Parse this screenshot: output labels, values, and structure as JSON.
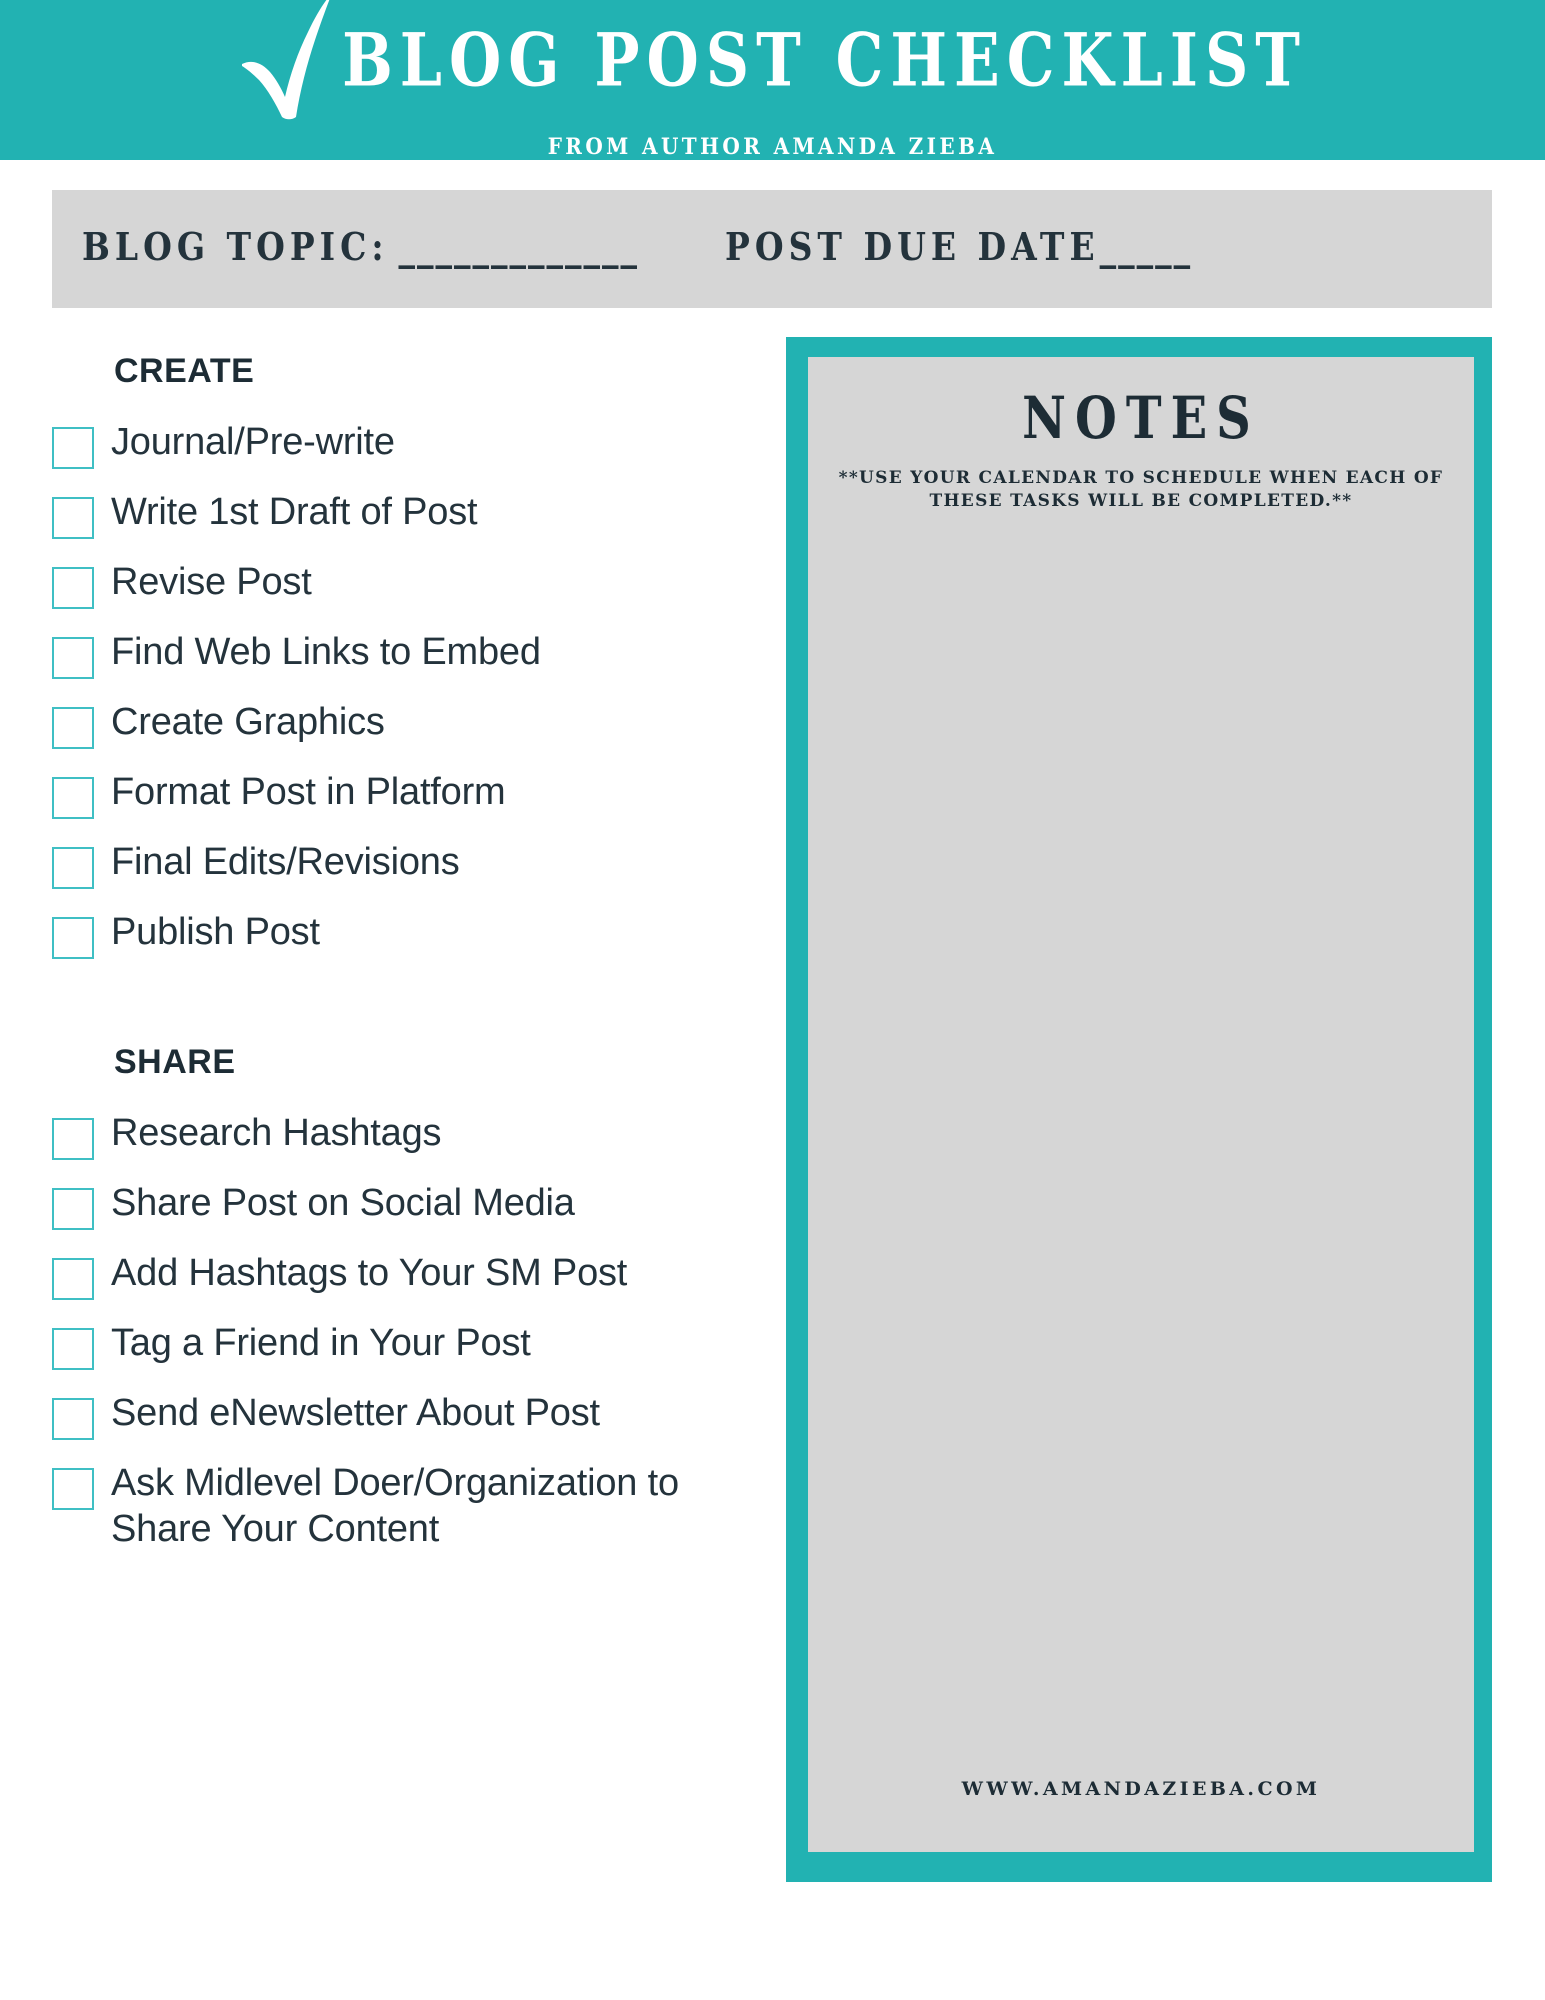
{
  "header": {
    "title": "BLOG POST CHECKLIST",
    "subtitle": "FROM AUTHOR AMANDA ZIEBA",
    "check_icon": "check-icon",
    "background_color": "#22b2b2"
  },
  "topic_bar": {
    "topic_label": "BLOG TOPIC:",
    "topic_rule": "_____________",
    "due_label": "POST DUE DATE",
    "due_rule": "_____",
    "background_color": "#d6d6d6"
  },
  "sections": [
    {
      "heading": "CREATE",
      "items": [
        "Journal/Pre-write",
        "Write 1st Draft of Post",
        "Revise Post",
        "Find Web Links to Embed",
        "Create Graphics",
        "Format Post in Platform",
        "Final Edits/Revisions",
        "Publish Post"
      ]
    },
    {
      "heading": "SHARE",
      "items": [
        "Research Hashtags",
        "Share Post on Social Media",
        "Add Hashtags to Your SM Post",
        "Tag a Friend in Your Post",
        "Send eNewsletter About Post",
        "Ask Midlevel Doer/Organization to Share Your Content"
      ]
    }
  ],
  "notes": {
    "title": "NOTES",
    "subtitle": "**USE YOUR CALENDAR TO SCHEDULE WHEN EACH OF THESE TASKS WILL BE COMPLETED.**",
    "url": "WWW.AMANDAZIEBA.COM",
    "border_color": "#22b2b2",
    "background_color": "#d6d6d6"
  },
  "colors": {
    "teal": "#22b2b2",
    "checkbox_border": "#3fbfc4",
    "text_dark": "#24333c",
    "gray_panel": "#d6d6d6"
  }
}
